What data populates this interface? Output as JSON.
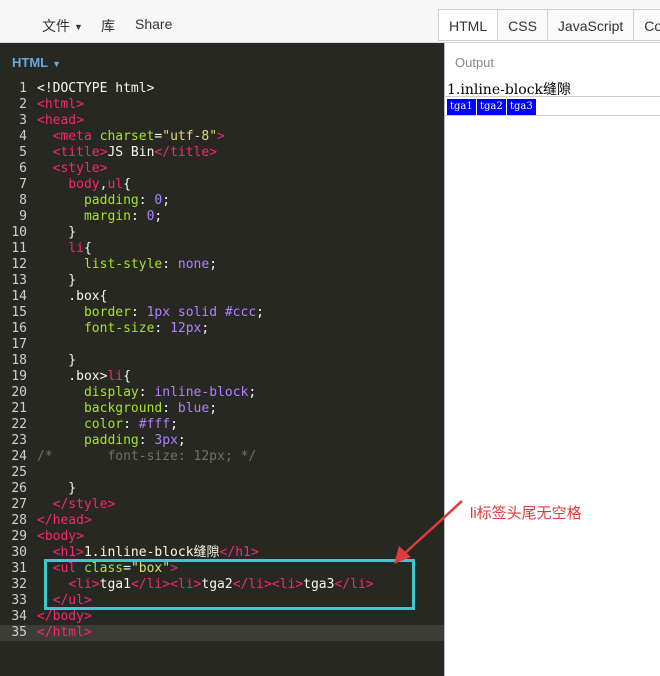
{
  "toolbar": {
    "file_label": "文件",
    "library_label": "库",
    "share_label": "Share",
    "tabs": [
      {
        "label": "HTML",
        "active": true
      },
      {
        "label": "CSS",
        "active": false
      },
      {
        "label": "JavaScript",
        "active": false
      },
      {
        "label": "Con",
        "active": false
      }
    ]
  },
  "editor": {
    "panel_label": "HTML",
    "lines": [
      {
        "n": "1",
        "parts": [
          [
            "plain",
            "<!DOCTYPE html>"
          ]
        ]
      },
      {
        "n": "2",
        "parts": [
          [
            "tag",
            "<html>"
          ]
        ]
      },
      {
        "n": "3",
        "parts": [
          [
            "tag",
            "<head>"
          ]
        ]
      },
      {
        "n": "4",
        "parts": [
          [
            "plain",
            "  "
          ],
          [
            "tag",
            "<meta "
          ],
          [
            "attr",
            "charset"
          ],
          [
            "plain",
            "="
          ],
          [
            "str",
            "\"utf-8\""
          ],
          [
            "tag",
            ">"
          ]
        ]
      },
      {
        "n": "5",
        "parts": [
          [
            "plain",
            "  "
          ],
          [
            "tag",
            "<title>"
          ],
          [
            "plain",
            "JS Bin"
          ],
          [
            "tag",
            "</title>"
          ]
        ]
      },
      {
        "n": "6",
        "parts": [
          [
            "plain",
            "  "
          ],
          [
            "tag",
            "<style>"
          ]
        ]
      },
      {
        "n": "7",
        "parts": [
          [
            "plain",
            "    "
          ],
          [
            "tag",
            "body"
          ],
          [
            "plain",
            ","
          ],
          [
            "tag",
            "ul"
          ],
          [
            "plain",
            "{"
          ]
        ]
      },
      {
        "n": "8",
        "parts": [
          [
            "plain",
            "      "
          ],
          [
            "attr",
            "padding"
          ],
          [
            "plain",
            ": "
          ],
          [
            "num",
            "0"
          ],
          [
            "plain",
            ";"
          ]
        ]
      },
      {
        "n": "9",
        "parts": [
          [
            "plain",
            "      "
          ],
          [
            "attr",
            "margin"
          ],
          [
            "plain",
            ": "
          ],
          [
            "num",
            "0"
          ],
          [
            "plain",
            ";"
          ]
        ]
      },
      {
        "n": "10",
        "parts": [
          [
            "plain",
            "    }"
          ]
        ]
      },
      {
        "n": "11",
        "parts": [
          [
            "plain",
            "    "
          ],
          [
            "tag",
            "li"
          ],
          [
            "plain",
            "{"
          ]
        ]
      },
      {
        "n": "12",
        "parts": [
          [
            "plain",
            "      "
          ],
          [
            "attr",
            "list-style"
          ],
          [
            "plain",
            ": "
          ],
          [
            "num",
            "none"
          ],
          [
            "plain",
            ";"
          ]
        ]
      },
      {
        "n": "13",
        "parts": [
          [
            "plain",
            "    }"
          ]
        ]
      },
      {
        "n": "14",
        "parts": [
          [
            "plain",
            "    .box{"
          ]
        ]
      },
      {
        "n": "15",
        "parts": [
          [
            "plain",
            "      "
          ],
          [
            "attr",
            "border"
          ],
          [
            "plain",
            ": "
          ],
          [
            "num",
            "1px solid #ccc"
          ],
          [
            "plain",
            ";"
          ]
        ]
      },
      {
        "n": "16",
        "parts": [
          [
            "plain",
            "      "
          ],
          [
            "attr",
            "font-size"
          ],
          [
            "plain",
            ": "
          ],
          [
            "num",
            "12px"
          ],
          [
            "plain",
            ";"
          ]
        ]
      },
      {
        "n": "17",
        "parts": [
          [
            "plain",
            ""
          ]
        ]
      },
      {
        "n": "18",
        "parts": [
          [
            "plain",
            "    }"
          ]
        ]
      },
      {
        "n": "19",
        "parts": [
          [
            "plain",
            "    .box>"
          ],
          [
            "tag",
            "li"
          ],
          [
            "plain",
            "{"
          ]
        ]
      },
      {
        "n": "20",
        "parts": [
          [
            "plain",
            "      "
          ],
          [
            "attr",
            "display"
          ],
          [
            "plain",
            ": "
          ],
          [
            "num",
            "inline-block"
          ],
          [
            "plain",
            ";"
          ]
        ]
      },
      {
        "n": "21",
        "parts": [
          [
            "plain",
            "      "
          ],
          [
            "attr",
            "background"
          ],
          [
            "plain",
            ": "
          ],
          [
            "num",
            "blue"
          ],
          [
            "plain",
            ";"
          ]
        ]
      },
      {
        "n": "22",
        "parts": [
          [
            "plain",
            "      "
          ],
          [
            "attr",
            "color"
          ],
          [
            "plain",
            ": "
          ],
          [
            "num",
            "#fff"
          ],
          [
            "plain",
            ";"
          ]
        ]
      },
      {
        "n": "23",
        "parts": [
          [
            "plain",
            "      "
          ],
          [
            "attr",
            "padding"
          ],
          [
            "plain",
            ": "
          ],
          [
            "num",
            "3px"
          ],
          [
            "plain",
            ";"
          ]
        ]
      },
      {
        "n": "24",
        "parts": [
          [
            "com",
            "/*       font-size: 12px; */"
          ]
        ]
      },
      {
        "n": "25",
        "parts": [
          [
            "plain",
            ""
          ]
        ]
      },
      {
        "n": "26",
        "parts": [
          [
            "plain",
            "    }"
          ]
        ]
      },
      {
        "n": "27",
        "parts": [
          [
            "plain",
            "  "
          ],
          [
            "tag",
            "</style>"
          ]
        ]
      },
      {
        "n": "28",
        "parts": [
          [
            "tag",
            "</head>"
          ]
        ]
      },
      {
        "n": "29",
        "parts": [
          [
            "tag",
            "<body>"
          ]
        ]
      },
      {
        "n": "30",
        "parts": [
          [
            "plain",
            "  "
          ],
          [
            "tag",
            "<h1>"
          ],
          [
            "plain",
            "1.inline-block缝隙"
          ],
          [
            "tag",
            "</h1>"
          ]
        ]
      },
      {
        "n": "31",
        "parts": [
          [
            "plain",
            "  "
          ],
          [
            "tag",
            "<ul "
          ],
          [
            "attr",
            "class"
          ],
          [
            "plain",
            "="
          ],
          [
            "str",
            "\"box\""
          ],
          [
            "tag",
            ">"
          ]
        ]
      },
      {
        "n": "32",
        "parts": [
          [
            "plain",
            "    "
          ],
          [
            "tag",
            "<li>"
          ],
          [
            "plain",
            "tga1"
          ],
          [
            "tag",
            "</li><li>"
          ],
          [
            "plain",
            "tga2"
          ],
          [
            "tag",
            "</li><li>"
          ],
          [
            "plain",
            "tga3"
          ],
          [
            "tag",
            "</li>"
          ]
        ]
      },
      {
        "n": "33",
        "parts": [
          [
            "plain",
            "  "
          ],
          [
            "tag",
            "</ul>"
          ]
        ]
      },
      {
        "n": "34",
        "parts": [
          [
            "tag",
            "</body>"
          ]
        ]
      },
      {
        "n": "35",
        "parts": [
          [
            "tag",
            "</html>"
          ]
        ]
      }
    ]
  },
  "output": {
    "panel_label": "Output",
    "heading": "1.inline-block缝隙",
    "items": [
      "tga1",
      "tga2",
      "tga3"
    ]
  },
  "annotation": {
    "text": "li标签头尾无空格",
    "color": "#e03a3a",
    "box_color": "#3fc9cf"
  },
  "colors": {
    "editor_bg": "#272822",
    "tag": "#f92672",
    "attr": "#a6e22e",
    "string": "#e6db74",
    "value": "#ae81ff",
    "li_bg": "#0000ff"
  }
}
